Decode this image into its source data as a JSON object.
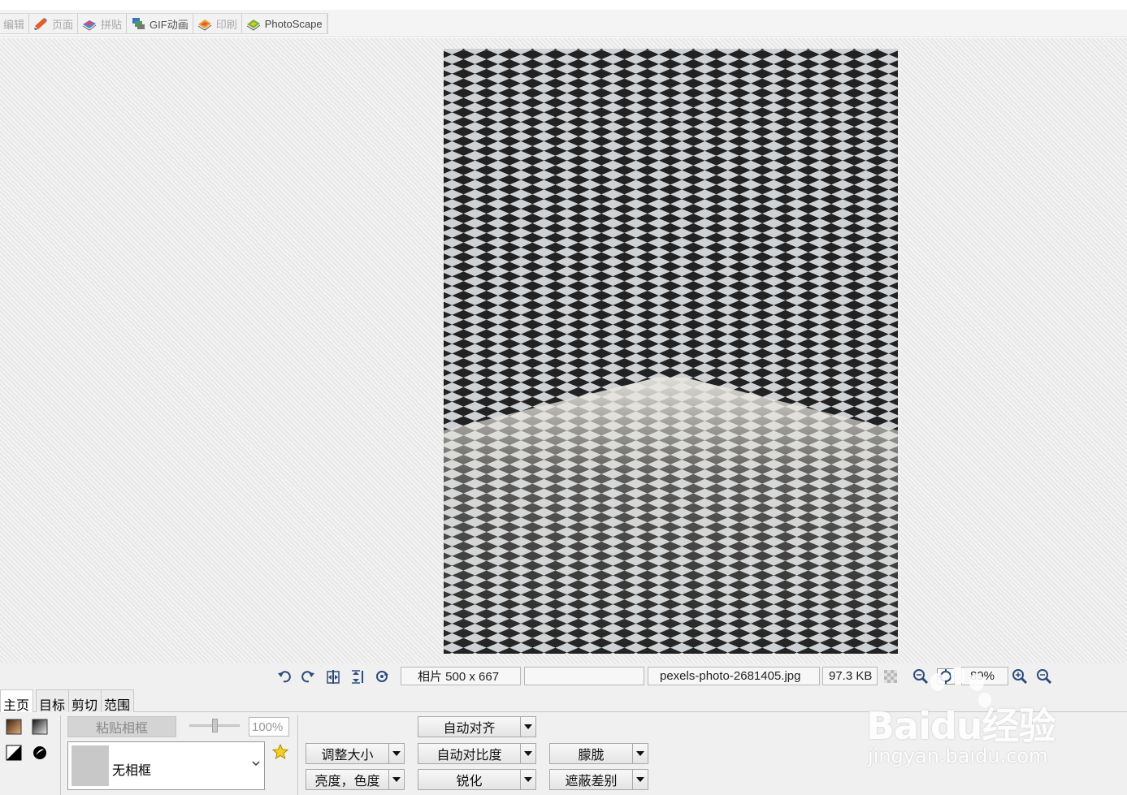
{
  "app_tabs": [
    {
      "label": "编辑"
    },
    {
      "label": "页面"
    },
    {
      "label": "拼贴"
    },
    {
      "label": "GIF动画"
    },
    {
      "label": "印刷"
    },
    {
      "label": "PhotoScape"
    }
  ],
  "status": {
    "photo_info": "相片 500 x 667",
    "empty_field": "",
    "filename": "pexels-photo-2681405.jpg",
    "filesize": "97.3 KB",
    "zoom": "89%"
  },
  "panel": {
    "tabs": [
      {
        "label": "主页"
      },
      {
        "label": "目标"
      },
      {
        "label": "剪切"
      },
      {
        "label": "范围"
      }
    ],
    "paste_frame": "粘贴相框",
    "opacity": "100%",
    "opacity_level": 0.5,
    "frame_select": "无相框",
    "resize": "调整大小",
    "brightness_color": "亮度，色度",
    "auto_level": "自动对齐",
    "auto_contrast": "自动对比度",
    "sharpen": "锐化",
    "blur": "朦胧",
    "mask_diff": "遮蔽差别"
  },
  "watermark": {
    "brand": "Baidu经验",
    "url": "jingyan.baidu.com"
  },
  "colors": {
    "accent": "#d9662a",
    "viewer_bg": "#ececec"
  }
}
